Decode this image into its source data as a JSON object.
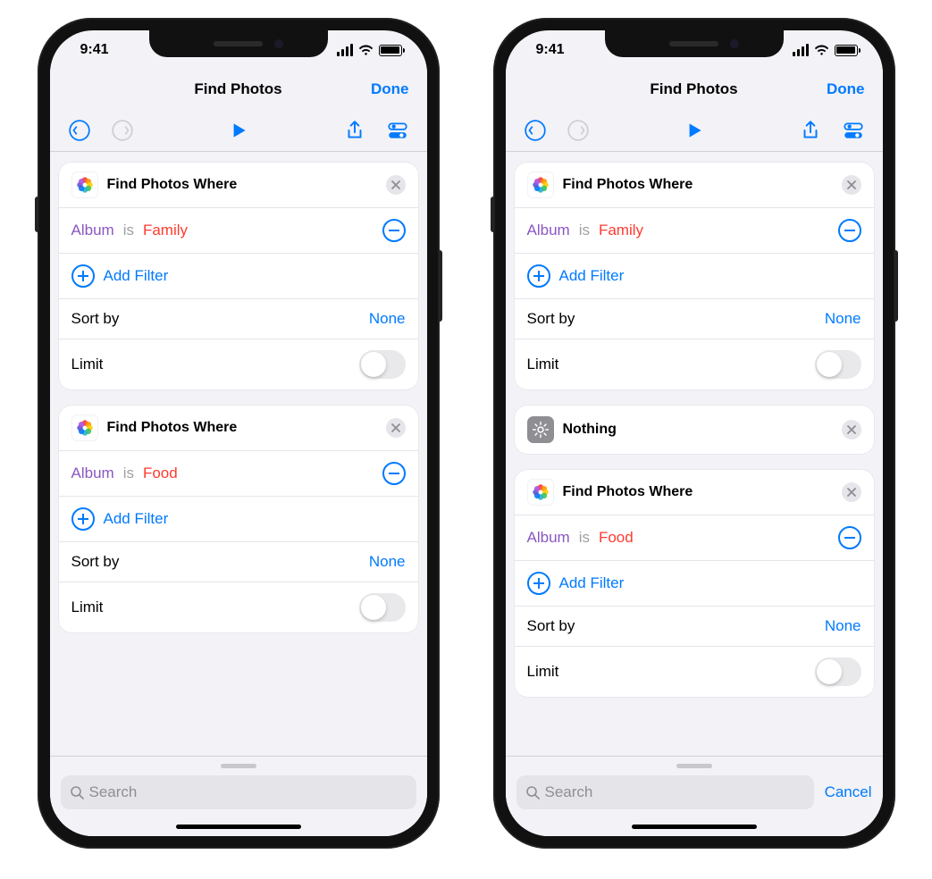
{
  "status": {
    "time": "9:41"
  },
  "nav": {
    "title": "Find Photos",
    "done": "Done"
  },
  "labels": {
    "add_filter": "Add Filter",
    "sort_by": "Sort by",
    "limit": "Limit",
    "search": "Search",
    "cancel": "Cancel"
  },
  "left": {
    "actions": [
      {
        "title": "Find Photos Where",
        "filter": {
          "field": "Album",
          "op": "is",
          "value": "Family"
        },
        "sort_value": "None",
        "limit_on": false
      },
      {
        "title": "Find Photos Where",
        "filter": {
          "field": "Album",
          "op": "is",
          "value": "Food"
        },
        "sort_value": "None",
        "limit_on": false
      }
    ]
  },
  "right": {
    "actions": [
      {
        "title": "Find Photos Where",
        "filter": {
          "field": "Album",
          "op": "is",
          "value": "Family"
        },
        "sort_value": "None",
        "limit_on": false
      },
      {
        "title": "Nothing",
        "nothing": true
      },
      {
        "title": "Find Photos Where",
        "filter": {
          "field": "Album",
          "op": "is",
          "value": "Food"
        },
        "sort_value": "None",
        "limit_on": false
      }
    ]
  }
}
